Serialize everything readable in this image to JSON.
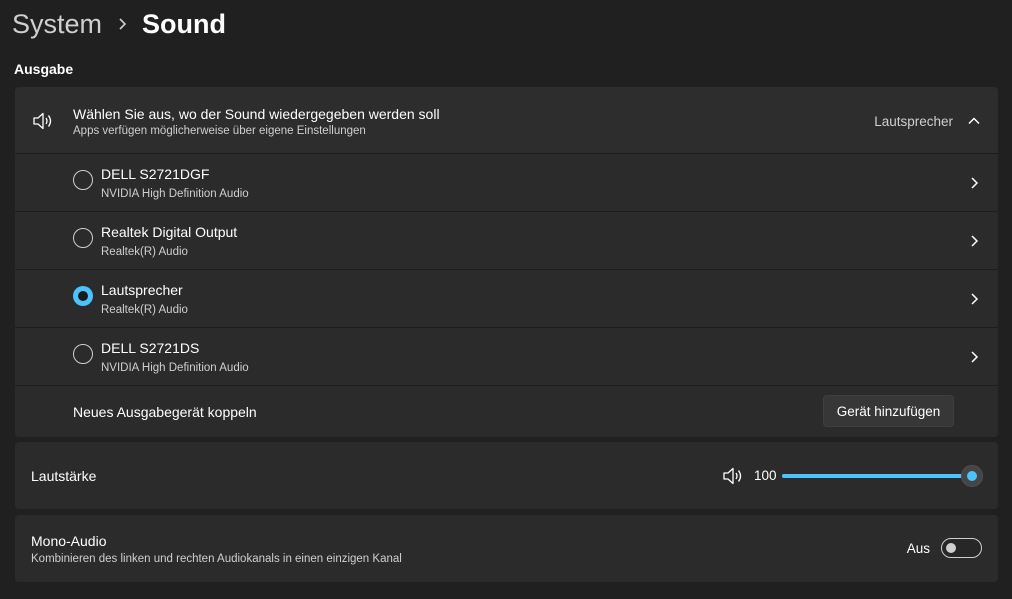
{
  "breadcrumb": {
    "parent": "System",
    "current": "Sound"
  },
  "output": {
    "section_label": "Ausgabe",
    "header": {
      "icon": "speaker-icon",
      "title": "Wählen Sie aus, wo der Sound wiedergegeben werden soll",
      "subtitle": "Apps verfügen möglicherweise über eigene Einstellungen",
      "selected_value": "Lautsprecher",
      "expanded": true
    },
    "devices": [
      {
        "name": "DELL S2721DGF",
        "driver": "NVIDIA High Definition Audio",
        "selected": false
      },
      {
        "name": "Realtek Digital Output",
        "driver": "Realtek(R) Audio",
        "selected": false
      },
      {
        "name": "Lautsprecher",
        "driver": "Realtek(R) Audio",
        "selected": true
      },
      {
        "name": "DELL S2721DS",
        "driver": "NVIDIA High Definition Audio",
        "selected": false
      }
    ],
    "pair": {
      "label": "Neues Ausgabegerät koppeln",
      "button_label": "Gerät hinzufügen"
    }
  },
  "volume": {
    "label": "Lautstärke",
    "value": "100",
    "level_percent": 100
  },
  "mono": {
    "title": "Mono-Audio",
    "subtitle": "Kombinieren des linken und rechten Audiokanals in einen einzigen Kanal",
    "state_label": "Aus",
    "enabled": false
  },
  "colors": {
    "background": "#202020",
    "card": "#2b2b2b",
    "accent": "#4cc2ff",
    "text_secondary": "#cfcfcf"
  }
}
